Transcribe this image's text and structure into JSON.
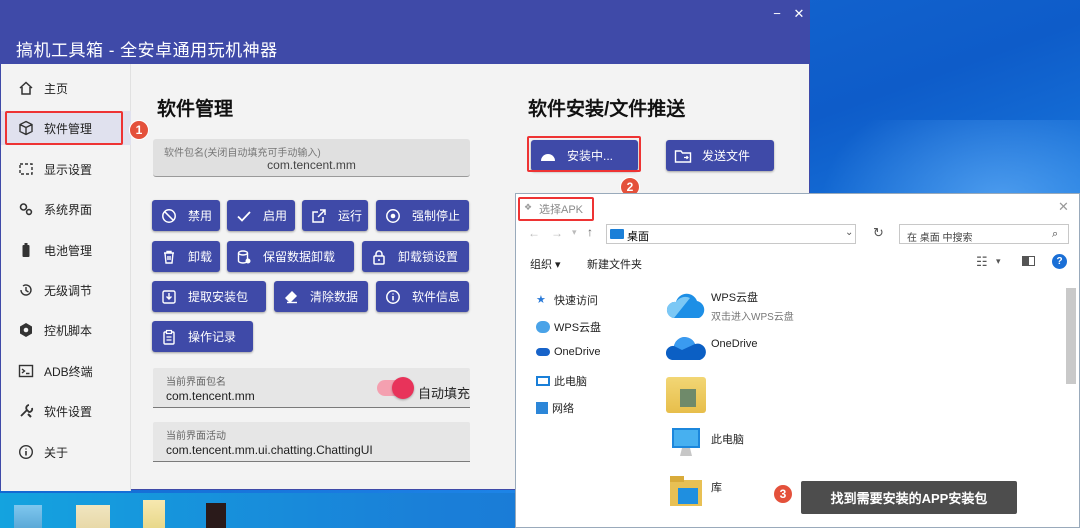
{
  "app": {
    "title": "搞机工具箱 - 全安卓通用玩机神器",
    "minimize_glyph": "−",
    "close_glyph": "✕",
    "accent": "#3f4aa8"
  },
  "sidebar": {
    "items": [
      {
        "label": "主页",
        "icon": "home-icon"
      },
      {
        "label": "软件管理",
        "icon": "cube-icon",
        "active": true
      },
      {
        "label": "显示设置",
        "icon": "display-icon"
      },
      {
        "label": "系统界面",
        "icon": "gears-icon"
      },
      {
        "label": "电池管理",
        "icon": "battery-icon"
      },
      {
        "label": "无级调节",
        "icon": "history-icon"
      },
      {
        "label": "控机脚本",
        "icon": "hexagon-icon"
      },
      {
        "label": "ADB终端",
        "icon": "terminal-icon"
      },
      {
        "label": "软件设置",
        "icon": "tools-icon"
      },
      {
        "label": "关于",
        "icon": "info-icon"
      }
    ]
  },
  "software": {
    "heading": "软件管理",
    "package_label": "软件包名(关闭自动填充可手动输入)",
    "package_value": "com.tencent.mm",
    "buttons": [
      "禁用",
      "启用",
      "运行",
      "强制停止",
      "卸载",
      "保留数据卸载",
      "卸载锁设置",
      "提取安装包",
      "清除数据",
      "软件信息",
      "操作记录"
    ],
    "current_pkg_label": "当前界面包名",
    "current_pkg_value": "com.tencent.mm",
    "current_activity_label": "当前界面活动",
    "current_activity_value": "com.tencent.mm.ui.chatting.ChattingUI",
    "autofill_label": "自动填充",
    "autofill_on": true
  },
  "install": {
    "heading": "软件安装/文件推送",
    "install_button": "安装中...",
    "push_button": "发送文件"
  },
  "steps": [
    "1",
    "2",
    "3"
  ],
  "dialog": {
    "title": "选择APK",
    "close_glyph": "✕",
    "address": "桌面",
    "search_placeholder": "在 桌面 中搜索",
    "organize": "组织 ▾",
    "new_folder": "新建文件夹",
    "tree": [
      "快速访问",
      "WPS云盘",
      "OneDrive",
      "此电脑",
      "网络"
    ],
    "files": [
      {
        "name": "WPS云盘",
        "sub": "双击进入WPS云盘"
      },
      {
        "name": "OneDrive",
        "sub": ""
      },
      {
        "name": "",
        "sub": ""
      },
      {
        "name": "此电脑",
        "sub": ""
      },
      {
        "name": "库",
        "sub": ""
      }
    ]
  },
  "tooltip": "找到需要安装的APP安装包"
}
